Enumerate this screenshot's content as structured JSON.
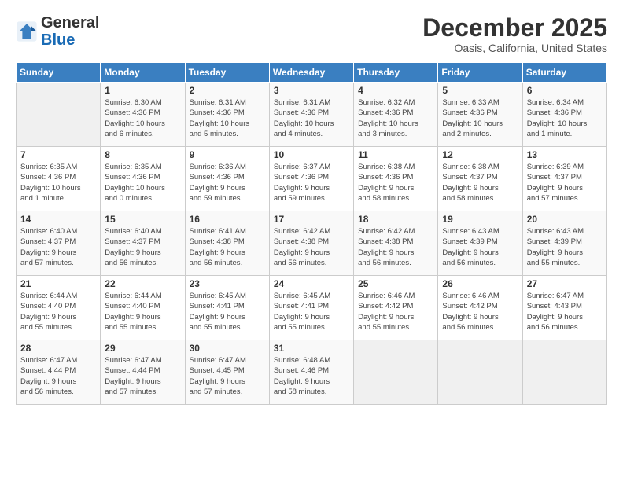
{
  "logo": {
    "text_general": "General",
    "text_blue": "Blue"
  },
  "header": {
    "title": "December 2025",
    "subtitle": "Oasis, California, United States"
  },
  "calendar": {
    "days_of_week": [
      "Sunday",
      "Monday",
      "Tuesday",
      "Wednesday",
      "Thursday",
      "Friday",
      "Saturday"
    ],
    "weeks": [
      [
        {
          "day": "",
          "info": ""
        },
        {
          "day": "1",
          "info": "Sunrise: 6:30 AM\nSunset: 4:36 PM\nDaylight: 10 hours\nand 6 minutes."
        },
        {
          "day": "2",
          "info": "Sunrise: 6:31 AM\nSunset: 4:36 PM\nDaylight: 10 hours\nand 5 minutes."
        },
        {
          "day": "3",
          "info": "Sunrise: 6:31 AM\nSunset: 4:36 PM\nDaylight: 10 hours\nand 4 minutes."
        },
        {
          "day": "4",
          "info": "Sunrise: 6:32 AM\nSunset: 4:36 PM\nDaylight: 10 hours\nand 3 minutes."
        },
        {
          "day": "5",
          "info": "Sunrise: 6:33 AM\nSunset: 4:36 PM\nDaylight: 10 hours\nand 2 minutes."
        },
        {
          "day": "6",
          "info": "Sunrise: 6:34 AM\nSunset: 4:36 PM\nDaylight: 10 hours\nand 1 minute."
        }
      ],
      [
        {
          "day": "7",
          "info": "Sunrise: 6:35 AM\nSunset: 4:36 PM\nDaylight: 10 hours\nand 1 minute."
        },
        {
          "day": "8",
          "info": "Sunrise: 6:35 AM\nSunset: 4:36 PM\nDaylight: 10 hours\nand 0 minutes."
        },
        {
          "day": "9",
          "info": "Sunrise: 6:36 AM\nSunset: 4:36 PM\nDaylight: 9 hours\nand 59 minutes."
        },
        {
          "day": "10",
          "info": "Sunrise: 6:37 AM\nSunset: 4:36 PM\nDaylight: 9 hours\nand 59 minutes."
        },
        {
          "day": "11",
          "info": "Sunrise: 6:38 AM\nSunset: 4:36 PM\nDaylight: 9 hours\nand 58 minutes."
        },
        {
          "day": "12",
          "info": "Sunrise: 6:38 AM\nSunset: 4:37 PM\nDaylight: 9 hours\nand 58 minutes."
        },
        {
          "day": "13",
          "info": "Sunrise: 6:39 AM\nSunset: 4:37 PM\nDaylight: 9 hours\nand 57 minutes."
        }
      ],
      [
        {
          "day": "14",
          "info": "Sunrise: 6:40 AM\nSunset: 4:37 PM\nDaylight: 9 hours\nand 57 minutes."
        },
        {
          "day": "15",
          "info": "Sunrise: 6:40 AM\nSunset: 4:37 PM\nDaylight: 9 hours\nand 56 minutes."
        },
        {
          "day": "16",
          "info": "Sunrise: 6:41 AM\nSunset: 4:38 PM\nDaylight: 9 hours\nand 56 minutes."
        },
        {
          "day": "17",
          "info": "Sunrise: 6:42 AM\nSunset: 4:38 PM\nDaylight: 9 hours\nand 56 minutes."
        },
        {
          "day": "18",
          "info": "Sunrise: 6:42 AM\nSunset: 4:38 PM\nDaylight: 9 hours\nand 56 minutes."
        },
        {
          "day": "19",
          "info": "Sunrise: 6:43 AM\nSunset: 4:39 PM\nDaylight: 9 hours\nand 56 minutes."
        },
        {
          "day": "20",
          "info": "Sunrise: 6:43 AM\nSunset: 4:39 PM\nDaylight: 9 hours\nand 55 minutes."
        }
      ],
      [
        {
          "day": "21",
          "info": "Sunrise: 6:44 AM\nSunset: 4:40 PM\nDaylight: 9 hours\nand 55 minutes."
        },
        {
          "day": "22",
          "info": "Sunrise: 6:44 AM\nSunset: 4:40 PM\nDaylight: 9 hours\nand 55 minutes."
        },
        {
          "day": "23",
          "info": "Sunrise: 6:45 AM\nSunset: 4:41 PM\nDaylight: 9 hours\nand 55 minutes."
        },
        {
          "day": "24",
          "info": "Sunrise: 6:45 AM\nSunset: 4:41 PM\nDaylight: 9 hours\nand 55 minutes."
        },
        {
          "day": "25",
          "info": "Sunrise: 6:46 AM\nSunset: 4:42 PM\nDaylight: 9 hours\nand 55 minutes."
        },
        {
          "day": "26",
          "info": "Sunrise: 6:46 AM\nSunset: 4:42 PM\nDaylight: 9 hours\nand 56 minutes."
        },
        {
          "day": "27",
          "info": "Sunrise: 6:47 AM\nSunset: 4:43 PM\nDaylight: 9 hours\nand 56 minutes."
        }
      ],
      [
        {
          "day": "28",
          "info": "Sunrise: 6:47 AM\nSunset: 4:44 PM\nDaylight: 9 hours\nand 56 minutes."
        },
        {
          "day": "29",
          "info": "Sunrise: 6:47 AM\nSunset: 4:44 PM\nDaylight: 9 hours\nand 57 minutes."
        },
        {
          "day": "30",
          "info": "Sunrise: 6:47 AM\nSunset: 4:45 PM\nDaylight: 9 hours\nand 57 minutes."
        },
        {
          "day": "31",
          "info": "Sunrise: 6:48 AM\nSunset: 4:46 PM\nDaylight: 9 hours\nand 58 minutes."
        },
        {
          "day": "",
          "info": ""
        },
        {
          "day": "",
          "info": ""
        },
        {
          "day": "",
          "info": ""
        }
      ]
    ]
  }
}
